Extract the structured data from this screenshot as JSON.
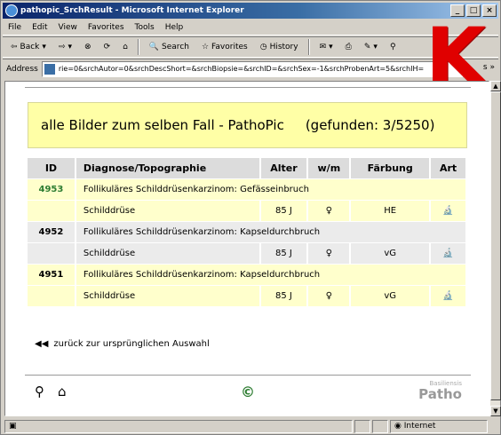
{
  "window": {
    "title": "pathopic_SrchResult     - Microsoft Internet Explorer",
    "minimize": "_",
    "maximize": "□",
    "close": "×"
  },
  "menu": [
    "File",
    "Edit",
    "View",
    "Favorites",
    "Tools",
    "Help"
  ],
  "toolbar": {
    "back": "Back",
    "search": "Search",
    "favorites": "Favorites",
    "history": "History"
  },
  "address": {
    "label": "Address",
    "url": "rie=0&srchAutor=0&srchDescShort=&srchBiopsie=&srchID=&srchSex=-1&srchProbenArt=5&srchIH=",
    "more": "»",
    "trailing": "s"
  },
  "overlay": {
    "letter": "K",
    "color": "#e00000"
  },
  "page": {
    "banner_title": "alle Bilder zum selben Fall - PathoPic",
    "banner_count": "(gefunden: 3/5250)",
    "table": {
      "headers": [
        "ID",
        "Diagnose/Topographie",
        "Alter",
        "w/m",
        "Färbung",
        "Art"
      ],
      "rows": [
        {
          "id": "4953",
          "diagnosis": "Follikuläres Schilddrüsenkarzinom: Gefässeinbruch",
          "topography": "Schilddrüse",
          "age": "85 J",
          "sex": "♀",
          "stain": "HE",
          "art": "🔬"
        },
        {
          "id": "4952",
          "diagnosis": "Follikuläres Schilddrüsenkarzinom: Kapseldurchbruch",
          "topography": "Schilddrüse",
          "age": "85 J",
          "sex": "♀",
          "stain": "vG",
          "art": "🔬"
        },
        {
          "id": "4951",
          "diagnosis": "Follikuläres Schilddrüsenkarzinom: Kapseldurchbruch",
          "topography": "Schilddrüse",
          "age": "85 J",
          "sex": "♀",
          "stain": "vG",
          "art": "🔬"
        }
      ]
    },
    "back_link": "zurück zur ursprünglichen Auswahl",
    "copyright": "©",
    "logo_small": "Basiliensis",
    "logo_big": "Patho"
  },
  "status": {
    "zone": "Internet"
  },
  "colors": {
    "banner_bg": "#ffffa6",
    "link_green": "#2e7d32"
  }
}
